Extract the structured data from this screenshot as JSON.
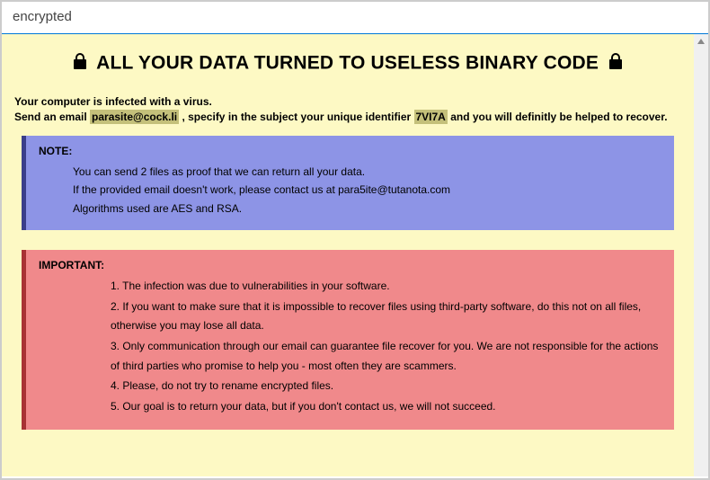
{
  "window": {
    "title": "encrypted"
  },
  "headline": "ALL YOUR DATA TURNED TO USELESS BINARY CODE",
  "intro": {
    "line1": "Your computer is infected with a virus.",
    "line2_pre": "Send an email ",
    "email": "parasite@cock.li",
    "line2_mid": " , specify in the subject your unique identifier ",
    "identifier": "7VI7A",
    "line2_post": " and you will definitly be helped to recover."
  },
  "note": {
    "title": "NOTE:",
    "lines": [
      "You can send 2 files as proof that we can return all your data.",
      "If the provided email doesn't work, please contact us at para5ite@tutanota.com",
      "Algorithms used are AES and RSA."
    ]
  },
  "important": {
    "title": "IMPORTANT:",
    "items": [
      "1. The infection was due to vulnerabilities in your software.",
      "2. If you want to make sure that it is impossible to recover files using third-party software, do this not on all files, otherwise you may lose all data.",
      "3. Only communication through our email can guarantee file recover for you. We are not responsible for the actions of third parties who promise to help you - most often they are scammers.",
      "4. Please, do not try to rename encrypted files.",
      "5. Our goal is to return your data, but if you don't contact us, we will not succeed."
    ]
  }
}
